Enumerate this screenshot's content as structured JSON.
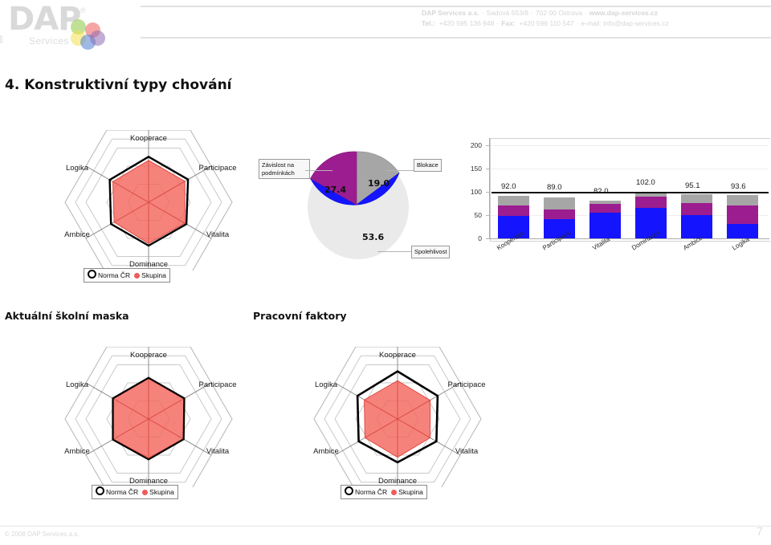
{
  "header": {
    "logo": {
      "text": "DAP",
      "registered": "®",
      "subtitle": "Services",
      "blob_colors": [
        "#8cc63f",
        "#f4e04d",
        "#ef5b5b",
        "#4f7fd0",
        "#8e6bb5"
      ]
    },
    "contact_line1_parts": [
      "DAP Services a.s.",
      "Sadová 553/8",
      "702 00 Ostrava",
      "www.dap-services.cz"
    ],
    "contact_line2_parts": [
      "Tel.:",
      "+420 595 136 948",
      "Fax:",
      "+420 596 110 547",
      "e-mail: info@dap-services.cz"
    ],
    "contact_line1": "DAP Services a.s.  ·  Sadová 553/8  ·  702 00 Ostrava  ·  www.dap-services.cz",
    "contact_line2": "Tel.:  +420 595 136 948  ·  Fax:  +420 596 110 547  ·  e-mail: info@dap-services.cz",
    "separator": "·"
  },
  "section": {
    "title": "4. Konstruktivní typy chování"
  },
  "sublabels": {
    "left": "Aktuální školní maska",
    "right": "Pracovní faktory"
  },
  "legend": {
    "norma": "Norma ČR",
    "skupina": "Skupina"
  },
  "chart_data": [
    {
      "id": "radar-top",
      "type": "radar",
      "title": "",
      "categories": [
        "Kooperace",
        "Participace",
        "Vitalita",
        "Dominance",
        "Ambice",
        "Logika"
      ],
      "axis_max": 100,
      "rings": 5,
      "series": [
        {
          "name": "Norma ČR",
          "color": "#000000",
          "fill": "none",
          "values": [
            63,
            60,
            58,
            60,
            60,
            62
          ]
        },
        {
          "name": "Skupina",
          "color": "#ef5b5b",
          "fill": "#f4675f",
          "values": [
            58,
            55,
            56,
            57,
            55,
            57
          ]
        }
      ],
      "legend_position": "bottom"
    },
    {
      "id": "pie-main",
      "type": "pie",
      "title": "",
      "labels": [
        "Blokace",
        "Spolehlivost",
        "Závislost na podmínkách"
      ],
      "values": [
        19.0,
        53.6,
        27.4
      ],
      "value_labels": [
        "19.0",
        "53.6",
        "27.4"
      ],
      "colors": [
        "#a6a6a6",
        "#1414ff",
        "#9c1d8f"
      ],
      "legend_position": "callouts"
    },
    {
      "id": "bars-main",
      "type": "bar",
      "stacked": true,
      "title": "",
      "categories": [
        "Kooperace",
        "Participace",
        "Vitalita",
        "Dominance",
        "Ambice",
        "Logika"
      ],
      "totals": [
        92.0,
        89.0,
        82.0,
        102.0,
        95.1,
        93.6
      ],
      "total_labels": [
        "92.0",
        "89.0",
        "82.0",
        "102.0",
        "95.1",
        "93.6"
      ],
      "series": [
        {
          "name": "Spolehlivost",
          "color": "#1414ff",
          "values": [
            49,
            42,
            55,
            67,
            51,
            32
          ]
        },
        {
          "name": "Závislost na podmínkách",
          "color": "#9c1d8f",
          "values": [
            23,
            21,
            19,
            24,
            25,
            40
          ]
        },
        {
          "name": "Blokace",
          "color": "#a6a6a6",
          "values": [
            20,
            26,
            8,
            11,
            19,
            22
          ]
        }
      ],
      "ylabel": "",
      "xlabel": "",
      "ylim": [
        0,
        220
      ],
      "yticks": [
        0,
        50,
        100,
        150,
        200
      ],
      "ytick_labels": [
        "0",
        "50",
        "100",
        "150",
        "200"
      ],
      "grid": true,
      "norm_line_value": 100,
      "norm_line_color": "#111111"
    },
    {
      "id": "radar-bottom-left",
      "type": "radar",
      "title": "Aktuální školní maska",
      "categories": [
        "Kooperace",
        "Participace",
        "Vitalita",
        "Dominance",
        "Ambice",
        "Logika"
      ],
      "axis_max": 100,
      "rings": 5,
      "series": [
        {
          "name": "Norma ČR",
          "color": "#000000",
          "fill": "none",
          "values": [
            57,
            57,
            56,
            56,
            56,
            57
          ]
        },
        {
          "name": "Skupina",
          "color": "#ef5b5b",
          "fill": "#f4675f",
          "values": [
            56,
            56,
            55,
            54,
            56,
            56
          ]
        }
      ],
      "legend_position": "bottom"
    },
    {
      "id": "radar-bottom-right",
      "type": "radar",
      "title": "Pracovní faktory",
      "categories": [
        "Kooperace",
        "Participace",
        "Vitalita",
        "Dominance",
        "Ambice",
        "Logika"
      ],
      "axis_max": 100,
      "rings": 5,
      "series": [
        {
          "name": "Norma ČR",
          "color": "#000000",
          "fill": "none",
          "values": [
            66,
            64,
            62,
            60,
            62,
            64
          ]
        },
        {
          "name": "Skupina",
          "color": "#ef5b5b",
          "fill": "#f4675f",
          "values": [
            53,
            52,
            52,
            53,
            52,
            53
          ]
        }
      ],
      "legend_position": "bottom"
    }
  ],
  "footer": {
    "copyright": "© 2008 DAP Services a.s.",
    "page_number": "7"
  }
}
